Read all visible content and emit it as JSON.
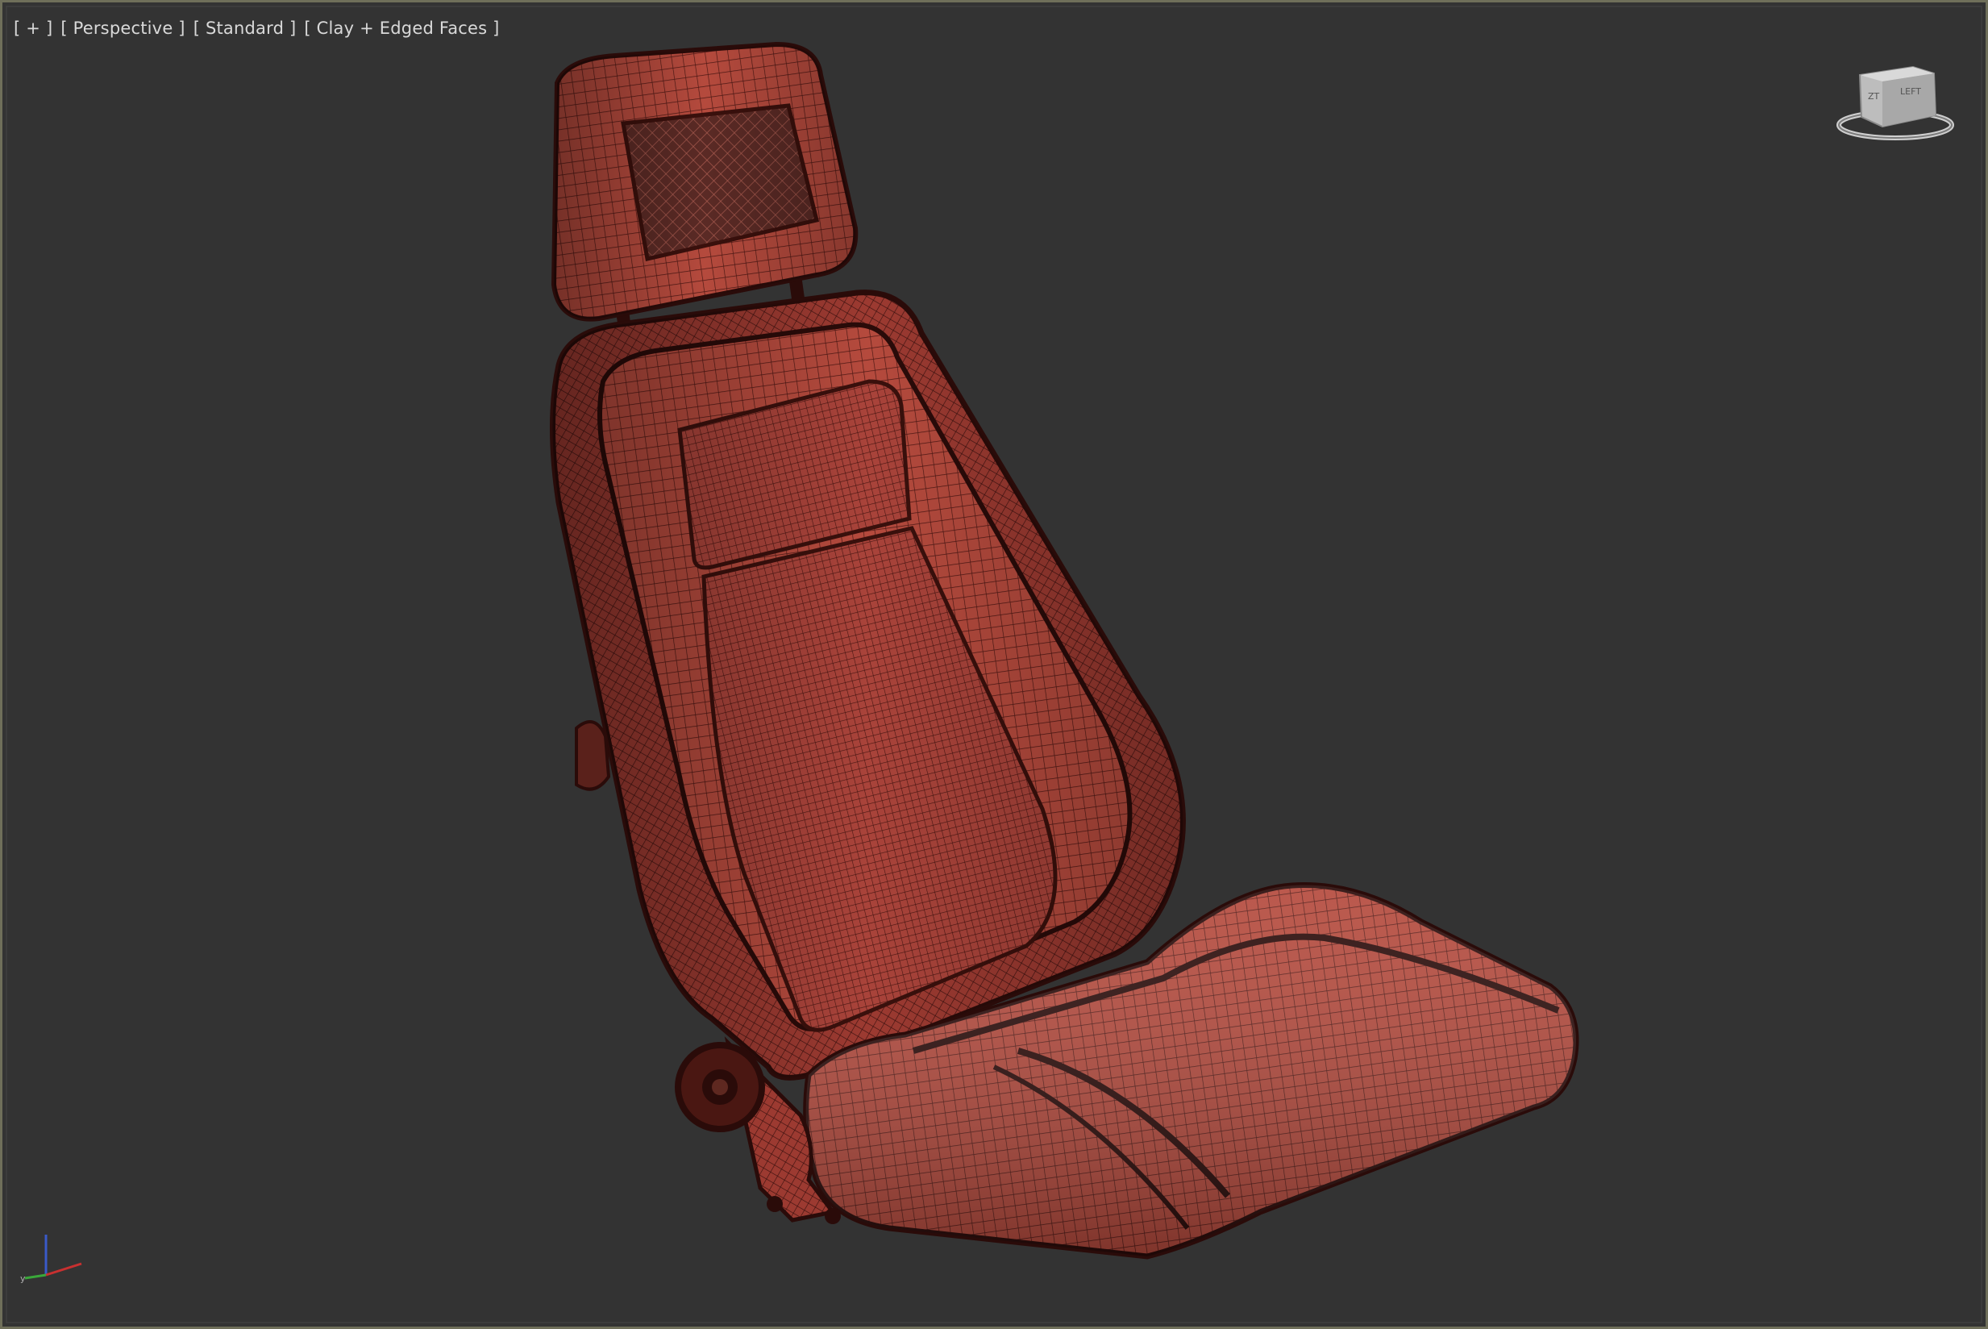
{
  "viewport": {
    "menu_plus": "[ + ]",
    "view_mode": "[ Perspective ]",
    "camera_mode": "[ Standard ]",
    "shading_mode": "[ Clay + Edged Faces ]"
  },
  "viewcube": {
    "icon": "viewcube-icon"
  },
  "axis": {
    "icon": "axis-tripod-icon"
  },
  "model": {
    "icon": "car-seat-model",
    "color": "#b84a3e",
    "wire_color": "#3a0f0c"
  }
}
